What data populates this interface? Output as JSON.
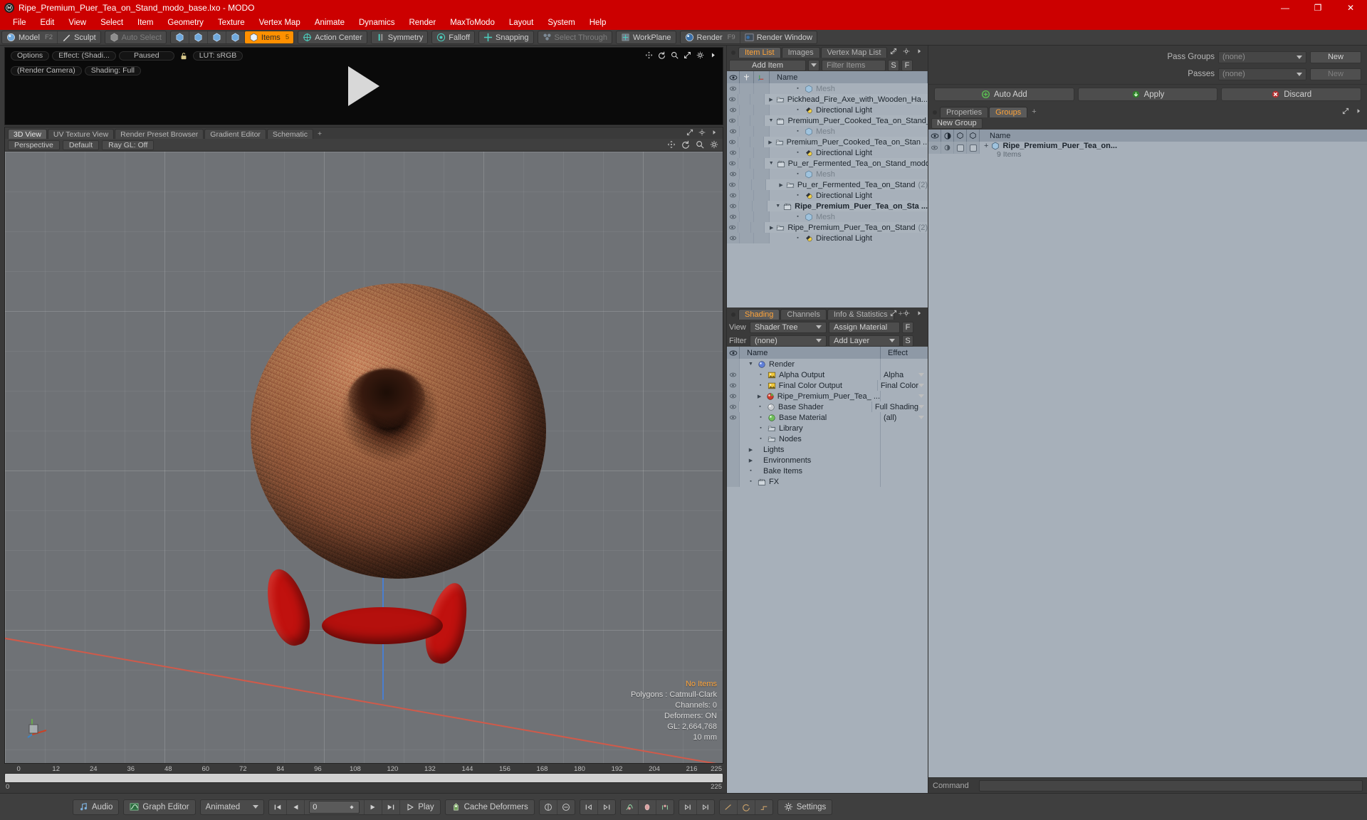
{
  "window": {
    "title": "Ripe_Premium_Puer_Tea_on_Stand_modo_base.lxo - MODO",
    "minimize": "—",
    "maximize": "❐",
    "close": "✕"
  },
  "menu": [
    "File",
    "Edit",
    "View",
    "Select",
    "Item",
    "Geometry",
    "Texture",
    "Vertex Map",
    "Animate",
    "Dynamics",
    "Render",
    "MaxToModo",
    "Layout",
    "System",
    "Help"
  ],
  "toolbar": {
    "mode": {
      "model": "Model",
      "model_key": "F2",
      "sculpt": "Sculpt"
    },
    "select": {
      "auto_select": "Auto Select"
    },
    "components": {
      "items": "Items",
      "items_key": "5"
    },
    "options": [
      "Action Center",
      "Symmetry",
      "Falloff",
      "Snapping",
      "Select Through",
      "WorkPlane"
    ],
    "render": {
      "render": "Render",
      "render_key": "F9",
      "render_window": "Render Window"
    }
  },
  "preview": {
    "options": "Options",
    "effect": "Effect: (Shadi...",
    "state": "Paused",
    "lut": "LUT: sRGB",
    "camera": "(Render Camera)",
    "shading": "Shading: Full"
  },
  "viewport": {
    "tabs": [
      "3D View",
      "UV Texture View",
      "Render Preset Browser",
      "Gradient Editor",
      "Schematic"
    ],
    "active_tab": "3D View",
    "plus": "+",
    "projection": "Perspective",
    "preset": "Default",
    "raygl": "Ray GL: Off",
    "stats": {
      "selection": "No Items",
      "polygons": "Polygons : Catmull-Clark",
      "channels": "Channels: 0",
      "deformers": "Deformers: ON",
      "gl": "GL: 2,664,768",
      "scale": "10 mm"
    },
    "ruler_ticks": [
      "0",
      "12",
      "24",
      "36",
      "48",
      "60",
      "72",
      "84",
      "96",
      "108",
      "120",
      "132",
      "144",
      "156",
      "168",
      "180",
      "192",
      "204",
      "216"
    ],
    "range_start": "0",
    "range_end": "225",
    "range_end_top": "225"
  },
  "item_list": {
    "tabs": [
      "Item List",
      "Images",
      "Vertex Map List"
    ],
    "active_tab": "Item List",
    "plus": "+",
    "add_item": "Add Item",
    "filter_placeholder": "Filter Items",
    "filter_value": "",
    "btn_s": "S",
    "btn_f": "F",
    "columns": {
      "name": "Name"
    },
    "rows": [
      {
        "indent": 2,
        "twist": "",
        "icon": "mesh",
        "label": "Mesh",
        "muted": true,
        "count": "",
        "bold": false
      },
      {
        "indent": 2,
        "twist": "right",
        "icon": "folder",
        "label": "Pickhead_Fire_Axe_with_Wooden_Ha...",
        "muted": false,
        "count": "",
        "bold": false
      },
      {
        "indent": 2,
        "twist": "",
        "icon": "light",
        "label": "Directional Light",
        "muted": false,
        "count": "",
        "bold": false
      },
      {
        "indent": 1,
        "twist": "down",
        "icon": "scene",
        "label": "Premium_Puer_Cooked_Tea_on_Stand_ ...",
        "muted": false,
        "count": "",
        "bold": false
      },
      {
        "indent": 2,
        "twist": "",
        "icon": "mesh",
        "label": "Mesh",
        "muted": true,
        "count": "",
        "bold": false
      },
      {
        "indent": 2,
        "twist": "right",
        "icon": "folder",
        "label": "Premium_Puer_Cooked_Tea_on_Stan ...",
        "muted": false,
        "count": "",
        "bold": false
      },
      {
        "indent": 2,
        "twist": "",
        "icon": "light",
        "label": "Directional Light",
        "muted": false,
        "count": "",
        "bold": false
      },
      {
        "indent": 1,
        "twist": "down",
        "icon": "scene",
        "label": "Pu_er_Fermented_Tea_on_Stand_modo ...",
        "muted": false,
        "count": "",
        "bold": false
      },
      {
        "indent": 2,
        "twist": "",
        "icon": "mesh",
        "label": "Mesh",
        "muted": true,
        "count": "",
        "bold": false
      },
      {
        "indent": 2,
        "twist": "right",
        "icon": "folder",
        "label": "Pu_er_Fermented_Tea_on_Stand",
        "muted": false,
        "count": "(2)",
        "bold": false
      },
      {
        "indent": 2,
        "twist": "",
        "icon": "light",
        "label": "Directional Light",
        "muted": false,
        "count": "",
        "bold": false
      },
      {
        "indent": 1,
        "twist": "down",
        "icon": "scene",
        "label": "Ripe_Premium_Puer_Tea_on_Sta ...",
        "muted": false,
        "count": "",
        "bold": true
      },
      {
        "indent": 2,
        "twist": "",
        "icon": "mesh",
        "label": "Mesh",
        "muted": true,
        "count": "",
        "bold": false
      },
      {
        "indent": 2,
        "twist": "right",
        "icon": "folder",
        "label": "Ripe_Premium_Puer_Tea_on_Stand",
        "muted": false,
        "count": "(2)",
        "bold": false
      },
      {
        "indent": 2,
        "twist": "",
        "icon": "light",
        "label": "Directional Light",
        "muted": false,
        "count": "",
        "bold": false
      }
    ]
  },
  "shading": {
    "tabs": [
      "Shading",
      "Channels",
      "Info & Statistics"
    ],
    "active_tab": "Shading",
    "plus": "+",
    "view_label": "View",
    "view_value": "Shader Tree",
    "assign_material": "Assign Material",
    "btn_f": "F",
    "filter_label": "Filter",
    "filter_value": "(none)",
    "add_layer": "Add Layer",
    "btn_s": "S",
    "columns": {
      "name": "Name",
      "effect": "Effect"
    },
    "rows": [
      {
        "indent": 0,
        "twist": "down",
        "icon": "sphere-blue",
        "label": "Render",
        "effect": "",
        "eye": false,
        "dd": false
      },
      {
        "indent": 1,
        "twist": "",
        "icon": "image",
        "label": "Alpha Output",
        "effect": "Alpha",
        "eye": true,
        "dd": true
      },
      {
        "indent": 1,
        "twist": "",
        "icon": "image",
        "label": "Final Color Output",
        "effect": "Final Color",
        "eye": true,
        "dd": true
      },
      {
        "indent": 1,
        "twist": "right",
        "icon": "sphere-red",
        "label": "Ripe_Premium_Puer_Tea_ ...",
        "effect": "",
        "eye": true,
        "dd": true
      },
      {
        "indent": 1,
        "twist": "",
        "icon": "sphere-grey",
        "label": "Base Shader",
        "effect": "Full Shading",
        "eye": true,
        "dd": true
      },
      {
        "indent": 1,
        "twist": "",
        "icon": "sphere-green",
        "label": "Base Material",
        "effect": "(all)",
        "eye": true,
        "dd": true
      },
      {
        "indent": 1,
        "twist": "",
        "icon": "folder",
        "label": "Library",
        "effect": "",
        "eye": false,
        "dd": false
      },
      {
        "indent": 1,
        "twist": "",
        "icon": "folder",
        "label": "Nodes",
        "effect": "",
        "eye": false,
        "dd": false
      },
      {
        "indent": 0,
        "twist": "right",
        "icon": "none",
        "label": "Lights",
        "effect": "",
        "eye": false,
        "dd": false
      },
      {
        "indent": 0,
        "twist": "right",
        "icon": "none",
        "label": "Environments",
        "effect": "",
        "eye": false,
        "dd": false
      },
      {
        "indent": 0,
        "twist": "",
        "icon": "none",
        "label": "Bake Items",
        "effect": "",
        "eye": false,
        "dd": false
      },
      {
        "indent": 0,
        "twist": "",
        "icon": "scene",
        "label": "FX",
        "effect": "",
        "eye": false,
        "dd": false
      }
    ]
  },
  "passes": {
    "pass_groups_label": "Pass Groups",
    "pass_groups_value": "(none)",
    "pass_groups_new": "New",
    "passes_label": "Passes",
    "passes_value": "(none)",
    "passes_new": "New",
    "auto_add": "Auto Add",
    "apply": "Apply",
    "discard": "Discard"
  },
  "groups": {
    "tabs": [
      "Properties",
      "Groups"
    ],
    "active_tab": "Groups",
    "plus": "+",
    "new_group": "New Group",
    "columns": {
      "name": "Name"
    },
    "rows": [
      {
        "label": "Ripe_Premium_Puer_Tea_on...",
        "sub": "9 Items",
        "expand": "+"
      }
    ]
  },
  "command": {
    "label": "Command",
    "value": ""
  },
  "statusbar": {
    "audio": "Audio",
    "graph_editor": "Graph Editor",
    "animated": "Animated",
    "frame": "0",
    "play": "Play",
    "cache_deformers": "Cache Deformers",
    "settings": "Settings"
  },
  "colors": {
    "title_bar": "#cc0000",
    "accent": "#ff9000",
    "active_tab_text": "#ffa43a",
    "panel_bg": "#3a3a3a",
    "list_bg": "#a7b0ba",
    "header_bg": "#8e99a6",
    "stand_red": "#c0110e"
  }
}
